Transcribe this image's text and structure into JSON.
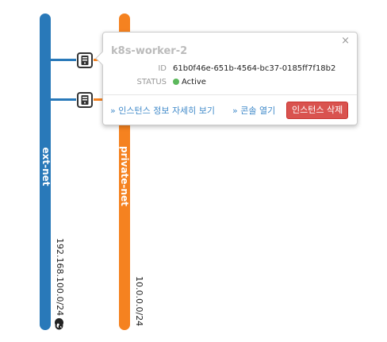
{
  "colors": {
    "ext_net": "#2979b9",
    "private_net": "#f58220",
    "delete": "#d9534f",
    "active": "#5cb85c"
  },
  "networks": [
    {
      "name": "ext-net",
      "cidr": "192.168.100.0/24"
    },
    {
      "name": "private-net",
      "cidr": "10.0.0.0/24"
    }
  ],
  "popup": {
    "title": "k8s-worker-2",
    "close": "×",
    "id_label": "ID",
    "id_value": "61b0f46e-651b-4564-bc37-0185ff7f18b2",
    "status_label": "STATUS",
    "status_value": "Active",
    "details_link": "» 인스턴스 정보 자세히 보기",
    "console_link": "» 콘솔 열기",
    "delete_button": "인스턴스 삭제"
  },
  "icons": {
    "instance": "server-icon",
    "globe": "globe-icon"
  }
}
